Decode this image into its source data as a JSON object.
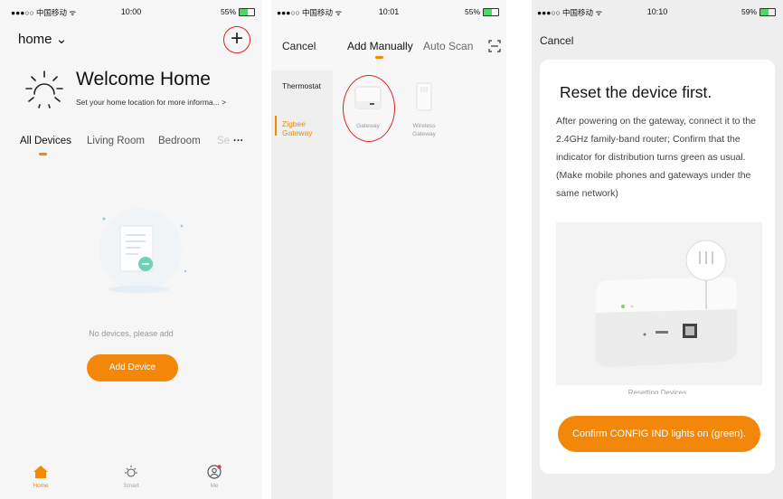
{
  "screens": [
    {
      "status": {
        "carrier": "●●●○○ 中国移动 ᯤ",
        "time": "10:00",
        "battery": "55%",
        "battery_level": 0.55
      },
      "home_selector": "home ⌄",
      "welcome_title": "Welcome Home",
      "welcome_sub": "Set your home location for more informa...  >",
      "tabs": [
        "All Devices",
        "Living Room",
        "Bedroom",
        "Se",
        "···"
      ],
      "empty_text": "No devices, please add",
      "add_button": "Add Device",
      "tabbar": [
        "Home",
        "Smart",
        "Me"
      ]
    },
    {
      "status": {
        "carrier": "●●●○○ 中国移动 ᯤ",
        "time": "10:01",
        "battery": "55%",
        "battery_level": 0.55
      },
      "cancel": "Cancel",
      "tabs": [
        "Add Manually",
        "Auto Scan"
      ],
      "sidebar": [
        "Thermostat",
        "Zigbee\nGateway"
      ],
      "devices": [
        "Gateway",
        "Wireless\nGateway"
      ]
    },
    {
      "status": {
        "carrier": "●●●○○ 中国移动 ᯤ",
        "time": "10:10",
        "battery": "59%",
        "battery_level": 0.59
      },
      "cancel": "Cancel",
      "title": "Reset the device first.",
      "description": "After powering on the gateway, connect it to the 2.4GHz family-band router; Confirm that the indicator for distribution turns green as usual.   (Make mobile phones and gateways under the same network)",
      "resetting_caption": "Resetting Devices",
      "confirm_button": "Confirm CONFIG IND lights on (green)."
    }
  ],
  "colors": {
    "accent": "#f3870a",
    "annotation": "#dd2222",
    "led": "#7ed957"
  }
}
